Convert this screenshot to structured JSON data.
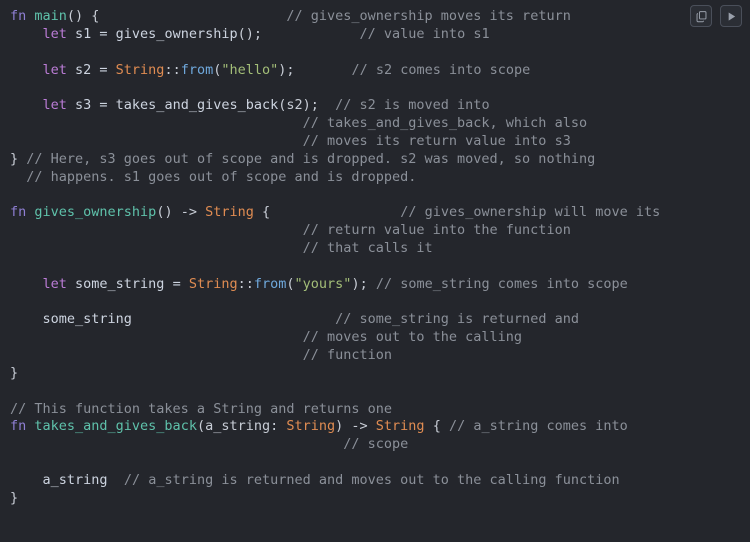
{
  "toolbar": {
    "copy_label": "Copy",
    "copy_icon": "copy-icon",
    "run_label": "Run",
    "run_icon": "play-icon",
    "border_color": "#4a4f5a"
  },
  "editor": {
    "background": "#24262c",
    "foreground": "#c8cdd6",
    "language": "rust",
    "font_size_px": 13.5,
    "line_height_px": 17.85,
    "colors": {
      "keyword": "#bb7cd6",
      "fn_keyword": "#8f7fd4",
      "function_name": "#5fc2ab",
      "type": "#e08c52",
      "method": "#6fa8dc",
      "string": "#a3be78",
      "comment": "#8b9099",
      "plain": "#c8cdd6"
    }
  },
  "code": {
    "lines": [
      [
        {
          "t": "fn ",
          "c": "t-fnkw"
        },
        {
          "t": "main",
          "c": "t-fnname"
        },
        {
          "t": "() {",
          "c": "t-pun"
        },
        {
          "t": "                       ",
          "c": "t-pun"
        },
        {
          "t": "// gives_ownership moves its return",
          "c": "t-cmt"
        }
      ],
      [
        {
          "t": "    ",
          "c": "t-pun"
        },
        {
          "t": "let ",
          "c": "t-kw"
        },
        {
          "t": "s1 = ",
          "c": "t-call"
        },
        {
          "t": "gives_ownership",
          "c": "t-call"
        },
        {
          "t": "();",
          "c": "t-pun"
        },
        {
          "t": "            ",
          "c": "t-pun"
        },
        {
          "t": "// value into s1",
          "c": "t-cmt"
        }
      ],
      [],
      [
        {
          "t": "    ",
          "c": "t-pun"
        },
        {
          "t": "let ",
          "c": "t-kw"
        },
        {
          "t": "s2 = ",
          "c": "t-call"
        },
        {
          "t": "String",
          "c": "t-type"
        },
        {
          "t": "::",
          "c": "t-pun"
        },
        {
          "t": "from",
          "c": "t-mac"
        },
        {
          "t": "(",
          "c": "t-pun"
        },
        {
          "t": "\"hello\"",
          "c": "t-str"
        },
        {
          "t": ");",
          "c": "t-pun"
        },
        {
          "t": "       ",
          "c": "t-pun"
        },
        {
          "t": "// s2 comes into scope",
          "c": "t-cmt"
        }
      ],
      [],
      [
        {
          "t": "    ",
          "c": "t-pun"
        },
        {
          "t": "let ",
          "c": "t-kw"
        },
        {
          "t": "s3 = ",
          "c": "t-call"
        },
        {
          "t": "takes_and_gives_back",
          "c": "t-call"
        },
        {
          "t": "(s2);",
          "c": "t-pun"
        },
        {
          "t": "  ",
          "c": "t-pun"
        },
        {
          "t": "// s2 is moved into",
          "c": "t-cmt"
        }
      ],
      [
        {
          "t": "                                    ",
          "c": "t-pun"
        },
        {
          "t": "// takes_and_gives_back, which also",
          "c": "t-cmt"
        }
      ],
      [
        {
          "t": "                                    ",
          "c": "t-pun"
        },
        {
          "t": "// moves its return value into s3",
          "c": "t-cmt"
        }
      ],
      [
        {
          "t": "} ",
          "c": "t-pun"
        },
        {
          "t": "// Here, s3 goes out of scope and is dropped. s2 was moved, so nothing",
          "c": "t-cmt"
        }
      ],
      [
        {
          "t": "  ",
          "c": "t-pun"
        },
        {
          "t": "// happens. s1 goes out of scope and is dropped.",
          "c": "t-cmt"
        }
      ],
      [],
      [
        {
          "t": "fn ",
          "c": "t-fnkw"
        },
        {
          "t": "gives_ownership",
          "c": "t-fnname"
        },
        {
          "t": "() -> ",
          "c": "t-pun"
        },
        {
          "t": "String",
          "c": "t-type"
        },
        {
          "t": " {",
          "c": "t-pun"
        },
        {
          "t": "                ",
          "c": "t-pun"
        },
        {
          "t": "// gives_ownership will move its",
          "c": "t-cmt"
        }
      ],
      [
        {
          "t": "                                    ",
          "c": "t-pun"
        },
        {
          "t": "// return value into the function",
          "c": "t-cmt"
        }
      ],
      [
        {
          "t": "                                    ",
          "c": "t-pun"
        },
        {
          "t": "// that calls it",
          "c": "t-cmt"
        }
      ],
      [],
      [
        {
          "t": "    ",
          "c": "t-pun"
        },
        {
          "t": "let ",
          "c": "t-kw"
        },
        {
          "t": "some_string = ",
          "c": "t-call"
        },
        {
          "t": "String",
          "c": "t-type"
        },
        {
          "t": "::",
          "c": "t-pun"
        },
        {
          "t": "from",
          "c": "t-mac"
        },
        {
          "t": "(",
          "c": "t-pun"
        },
        {
          "t": "\"yours\"",
          "c": "t-str"
        },
        {
          "t": "); ",
          "c": "t-pun"
        },
        {
          "t": "// some_string comes into scope",
          "c": "t-cmt"
        }
      ],
      [],
      [
        {
          "t": "    ",
          "c": "t-pun"
        },
        {
          "t": "some_string",
          "c": "t-call"
        },
        {
          "t": "                         ",
          "c": "t-pun"
        },
        {
          "t": "// some_string is returned and",
          "c": "t-cmt"
        }
      ],
      [
        {
          "t": "                                    ",
          "c": "t-pun"
        },
        {
          "t": "// moves out to the calling",
          "c": "t-cmt"
        }
      ],
      [
        {
          "t": "                                    ",
          "c": "t-pun"
        },
        {
          "t": "// function",
          "c": "t-cmt"
        }
      ],
      [
        {
          "t": "}",
          "c": "t-pun"
        }
      ],
      [],
      [
        {
          "t": "// This function takes a String and returns one",
          "c": "t-cmt"
        }
      ],
      [
        {
          "t": "fn ",
          "c": "t-fnkw"
        },
        {
          "t": "takes_and_gives_back",
          "c": "t-fnname"
        },
        {
          "t": "(a_string: ",
          "c": "t-pun"
        },
        {
          "t": "String",
          "c": "t-type"
        },
        {
          "t": ") -> ",
          "c": "t-pun"
        },
        {
          "t": "String",
          "c": "t-type"
        },
        {
          "t": " { ",
          "c": "t-pun"
        },
        {
          "t": "// a_string comes into",
          "c": "t-cmt"
        }
      ],
      [
        {
          "t": "                                         ",
          "c": "t-pun"
        },
        {
          "t": "// scope",
          "c": "t-cmt"
        }
      ],
      [],
      [
        {
          "t": "    ",
          "c": "t-pun"
        },
        {
          "t": "a_string",
          "c": "t-call"
        },
        {
          "t": "  ",
          "c": "t-pun"
        },
        {
          "t": "// a_string is returned and moves out to the calling function",
          "c": "t-cmt"
        }
      ],
      [
        {
          "t": "}",
          "c": "t-pun"
        }
      ]
    ]
  }
}
